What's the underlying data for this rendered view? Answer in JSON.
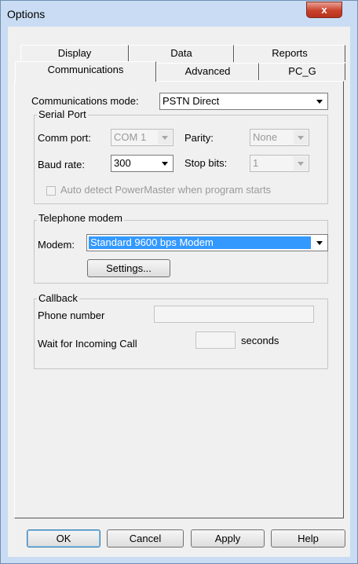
{
  "window": {
    "title": "Options",
    "close_glyph": "x"
  },
  "tabs": {
    "row_back": [
      "Display",
      "Data",
      "Reports"
    ],
    "row_front": [
      "Communications",
      "Advanced",
      "PC_G"
    ],
    "active": "Communications"
  },
  "communications": {
    "mode_label": "Communications mode:",
    "mode_value": "PSTN Direct"
  },
  "serial_port": {
    "title": "Serial Port",
    "comm_port_label": "Comm port:",
    "comm_port_value": "COM 1",
    "parity_label": "Parity:",
    "parity_value": "None",
    "baud_rate_label": "Baud rate:",
    "baud_rate_value": "300",
    "stop_bits_label": "Stop bits:",
    "stop_bits_value": "1",
    "auto_detect_label": "Auto detect PowerMaster when program starts"
  },
  "telephone_modem": {
    "title": "Telephone modem",
    "modem_label": "Modem:",
    "modem_value": "Standard  9600 bps Modem",
    "settings_button": "Settings..."
  },
  "callback": {
    "title": "Callback",
    "phone_number_label": "Phone number",
    "wait_label": "Wait for Incoming Call",
    "seconds_label": "seconds"
  },
  "buttons": {
    "ok": "OK",
    "cancel": "Cancel",
    "apply": "Apply",
    "help": "Help"
  }
}
